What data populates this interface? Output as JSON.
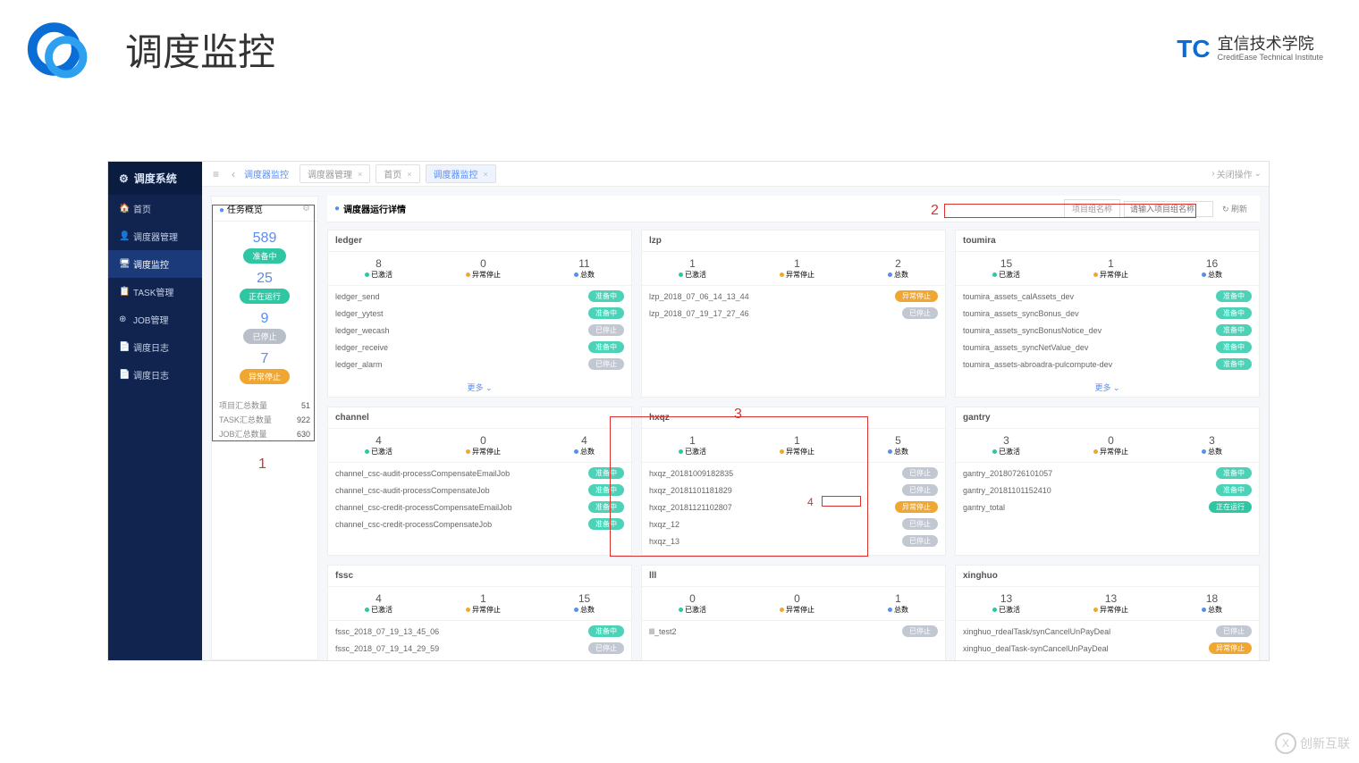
{
  "slide": {
    "title": "调度监控",
    "brand_cn": "宜信技术学院",
    "brand_en": "CreditEase Technical Institute",
    "brand_mark": "TC"
  },
  "sidebar": {
    "title": "调度系统",
    "items": [
      {
        "icon": "🏠",
        "label": "首页"
      },
      {
        "icon": "👤",
        "label": "调度器管理"
      },
      {
        "icon": "🖥",
        "label": "调度监控"
      },
      {
        "icon": "📋",
        "label": "TASK管理"
      },
      {
        "icon": "⊕",
        "label": "JOB管理"
      },
      {
        "icon": "📄",
        "label": "调度日志"
      },
      {
        "icon": "📄",
        "label": "调度日志"
      }
    ],
    "active_index": 2
  },
  "topbar": {
    "breadcrumb": "调度器监控",
    "tabs": [
      {
        "label": "调度器管理"
      },
      {
        "label": "首页"
      },
      {
        "label": "调度器监控"
      }
    ],
    "active_tab": 2,
    "right_action": "关闭操作"
  },
  "overview": {
    "title": "任务概览",
    "stats": [
      {
        "num": "589",
        "badge": "准备中",
        "cls": "bd-ready"
      },
      {
        "num": "25",
        "badge": "正在运行",
        "cls": "bd-running"
      },
      {
        "num": "9",
        "badge": "已停止",
        "cls": "bd-stopped"
      },
      {
        "num": "7",
        "badge": "异常停止",
        "cls": "bd-abnormal"
      }
    ],
    "totals": [
      {
        "label": "项目汇总数量",
        "value": "51"
      },
      {
        "label": "TASK汇总数量",
        "value": "922"
      },
      {
        "label": "JOB汇总数量",
        "value": "630"
      }
    ]
  },
  "details": {
    "title": "调度器运行详情",
    "search_label": "项目组名称",
    "search_placeholder": "请输入项目组名称",
    "search_btn": "↻ 刷新"
  },
  "stat_labels": {
    "active": "已激活",
    "abnormal": "异常停止",
    "total": "总数"
  },
  "status_text": {
    "ready": "准备中",
    "stopped": "已停止",
    "abnormal": "异常停止",
    "running": "正在运行"
  },
  "more_text": "更多 ⌄",
  "cards": [
    {
      "name": "ledger",
      "stats": {
        "active": "8",
        "abnormal": "0",
        "total": "11"
      },
      "rows": [
        {
          "name": "ledger_send",
          "status": "ready"
        },
        {
          "name": "ledger_yytest",
          "status": "ready"
        },
        {
          "name": "ledger_wecash",
          "status": "stopped"
        },
        {
          "name": "ledger_receive",
          "status": "ready"
        },
        {
          "name": "ledger_alarm",
          "status": "stopped"
        }
      ],
      "more": true
    },
    {
      "name": "lzp",
      "stats": {
        "active": "1",
        "abnormal": "1",
        "total": "2"
      },
      "rows": [
        {
          "name": "lzp_2018_07_06_14_13_44",
          "status": "abnormal"
        },
        {
          "name": "lzp_2018_07_19_17_27_46",
          "status": "stopped"
        }
      ]
    },
    {
      "name": "toumira",
      "stats": {
        "active": "15",
        "abnormal": "1",
        "total": "16"
      },
      "rows": [
        {
          "name": "toumira_assets_calAssets_dev",
          "status": "ready"
        },
        {
          "name": "toumira_assets_syncBonus_dev",
          "status": "ready"
        },
        {
          "name": "toumira_assets_syncBonusNotice_dev",
          "status": "ready"
        },
        {
          "name": "toumira_assets_syncNetValue_dev",
          "status": "ready"
        },
        {
          "name": "toumira_assets-abroadra-pulcompute-dev",
          "status": "ready"
        }
      ],
      "more": true
    },
    {
      "name": "channel",
      "stats": {
        "active": "4",
        "abnormal": "0",
        "total": "4"
      },
      "rows": [
        {
          "name": "channel_csc-audit-processCompensateEmailJob",
          "status": "ready"
        },
        {
          "name": "channel_csc-audit-processCompensateJob",
          "status": "ready"
        },
        {
          "name": "channel_csc-credit-processCompensateEmailJob",
          "status": "ready"
        },
        {
          "name": "channel_csc-credit-processCompensateJob",
          "status": "ready"
        }
      ]
    },
    {
      "name": "hxqz",
      "stats": {
        "active": "1",
        "abnormal": "1",
        "total": "5"
      },
      "rows": [
        {
          "name": "hxqz_20181009182835",
          "status": "stopped"
        },
        {
          "name": "hxqz_20181101181829",
          "status": "stopped"
        },
        {
          "name": "hxqz_20181121102807",
          "status": "abnormal"
        },
        {
          "name": "hxqz_12",
          "status": "stopped"
        },
        {
          "name": "hxqz_13",
          "status": "stopped"
        }
      ]
    },
    {
      "name": "gantry",
      "stats": {
        "active": "3",
        "abnormal": "0",
        "total": "3"
      },
      "rows": [
        {
          "name": "gantry_20180726101057",
          "status": "ready"
        },
        {
          "name": "gantry_20181101152410",
          "status": "ready"
        },
        {
          "name": "gantry_total",
          "status": "running"
        }
      ]
    },
    {
      "name": "fssc",
      "stats": {
        "active": "4",
        "abnormal": "1",
        "total": "15"
      },
      "rows": [
        {
          "name": "fssc_2018_07_19_13_45_06",
          "status": "ready"
        },
        {
          "name": "fssc_2018_07_19_14_29_59",
          "status": "stopped"
        }
      ]
    },
    {
      "name": "lll",
      "stats": {
        "active": "0",
        "abnormal": "0",
        "total": "1"
      },
      "rows": [
        {
          "name": "lll_test2",
          "status": "stopped"
        }
      ]
    },
    {
      "name": "xinghuo",
      "stats": {
        "active": "13",
        "abnormal": "13",
        "total": "18"
      },
      "rows": [
        {
          "name": "xinghuo_rdealTask/synCancelUnPayDeal",
          "status": "stopped"
        },
        {
          "name": "xinghuo_dealTask-synCancelUnPayDeal",
          "status": "abnormal"
        }
      ]
    }
  ],
  "annotations": {
    "1": "1",
    "2": "2",
    "3": "3",
    "4": "4"
  },
  "watermark": "创新互联"
}
